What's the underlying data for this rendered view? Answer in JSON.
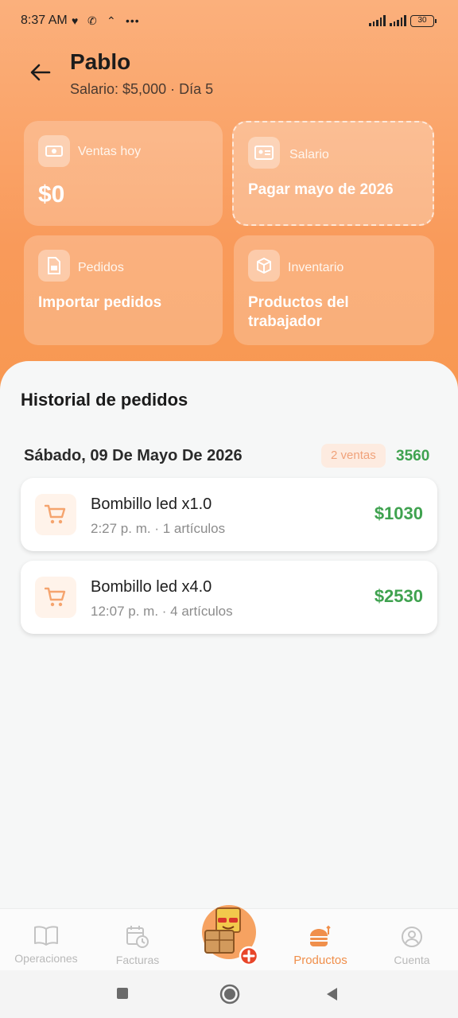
{
  "status_bar": {
    "time": "8:37 AM",
    "battery": "30"
  },
  "header": {
    "title": "Pablo",
    "subtitle": "Salario: $5,000 · Día 5"
  },
  "cards": {
    "sales": {
      "label": "Ventas hoy",
      "value": "$0",
      "icon": "money-icon"
    },
    "salary": {
      "label": "Salario",
      "value": "Pagar mayo de 2026",
      "icon": "id-card-icon"
    },
    "orders": {
      "label": "Pedidos",
      "value": "Importar pedidos",
      "icon": "file-import-icon"
    },
    "inventory": {
      "label": "Inventario",
      "value_line1": "Productos del",
      "value_line2": "trabajador",
      "icon": "box-icon"
    }
  },
  "history": {
    "title": "Historial de pedidos",
    "groups": [
      {
        "date": "Sábado, 09 De Mayo De 2026",
        "badge": "2 ventas",
        "total": "3560",
        "orders": [
          {
            "name": "Bombillo led x1.0",
            "meta": "2:27 p. m. · 1 artículos",
            "amount": "$1030"
          },
          {
            "name": "Bombillo led x4.0",
            "meta": "12:07 p. m. · 4 artículos",
            "amount": "$2530"
          }
        ]
      }
    ]
  },
  "nav": {
    "items": [
      {
        "label": "Operaciones",
        "icon": "book-icon"
      },
      {
        "label": "Facturas",
        "icon": "calendar-clock-icon"
      },
      {
        "label": "Productos",
        "icon": "burger-icon",
        "active": true
      },
      {
        "label": "Cuenta",
        "icon": "user-circle-icon"
      }
    ]
  },
  "colors": {
    "accent": "#f99a5a",
    "success": "#3fa24f",
    "nav_active": "#f08f4b"
  }
}
